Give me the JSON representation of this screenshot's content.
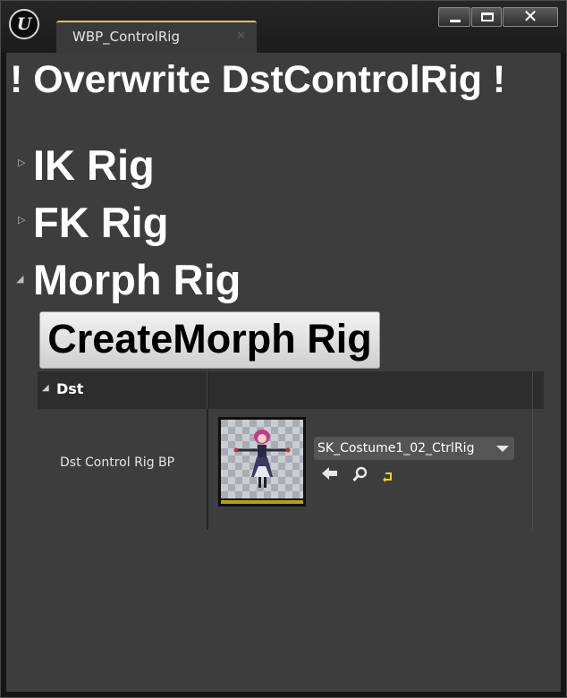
{
  "window": {
    "tab_title": "WBP_ControlRig",
    "tab_close": "✕",
    "close_glyph": "✕",
    "logo": "U"
  },
  "main": {
    "heading": "! Overwrite DstControlRig !",
    "sections": [
      {
        "label": "IK Rig",
        "expanded": false
      },
      {
        "label": "FK Rig",
        "expanded": false
      },
      {
        "label": "Morph Rig",
        "expanded": true
      }
    ],
    "create_button": "CreateMorph Rig",
    "dst": {
      "header": "Dst",
      "property_label": "Dst Control Rig BP",
      "asset_value": "SK_Costume1_02_CtrlRig",
      "tools": [
        "arrow-left-icon",
        "search-icon",
        "reset-icon"
      ]
    }
  },
  "colors": {
    "panel": "#3d3d3d",
    "tab_accent": "#d8c65a",
    "thumbnail_bar": "#b8a00c"
  }
}
